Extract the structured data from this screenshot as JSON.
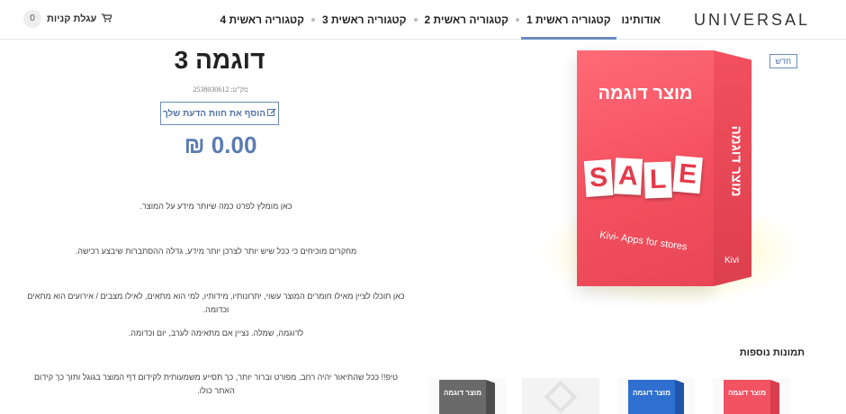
{
  "header": {
    "logo": "UNIVERSAL",
    "nav": [
      "אודותינו",
      "קטגוריה ראשית 1",
      "קטגוריה ראשית 2",
      "קטגוריה ראשית 3",
      "קטגוריה ראשית 4"
    ],
    "active_nav": "קטגוריה ראשית 1",
    "cart_label": "עגלת קניות",
    "cart_count": "0",
    "cart_icon": "shopping-cart-icon"
  },
  "product": {
    "title": "דוגמה 3",
    "sku": "מק\"ט: 2538030612",
    "review_button": "הוסף את חוות הדעת שלך",
    "review_icon": "edit-icon",
    "price": "₪ 0.00",
    "new_badge": "חדש",
    "description": [
      "כאן מומלץ לפרט כמה שיותר מידע על המוצר.",
      "מחקרים מוכיחים כי ככל שיש יותר לצרכן יותר מידע, גדלה ההסתברות שיבצע רכישה.",
      "כאן תוכלו לציין מאילו חומרים המוצר עשוי, יתרונותיו, מידותיו, למי הוא מתאים, לאילו מצבים / אירועים הוא מתאים וכדומה.",
      "לדוגמה, שמלה. נציין אם מתאימה לערב, יום וכדומה.",
      "טיפ!! ככל שהתיאור יהיה רחב, מפורט וברור יותר, כך תסייע משמעותית לקידום דף המוצר בגוגל ותוך כך קידום האתר כולו."
    ]
  },
  "main_image": {
    "box_title": "מוצר דוגמה",
    "side_text": "מוצר דוגמה",
    "sale_letters": [
      "S",
      "A",
      "L",
      "E"
    ],
    "tagline": "Kivi- Apps for stores",
    "brand": "Kivi",
    "colors": {
      "box": "#f4505f",
      "accent": "#5b7bb3"
    }
  },
  "thumbnails": {
    "title": "תמונות נוספות",
    "items": [
      {
        "label": "מוצר דוגמה",
        "color": "red"
      },
      {
        "label": "מוצר דוגמה",
        "color": "blue"
      },
      {
        "label": "",
        "color": "placeholder"
      },
      {
        "label": "מוצר דוגמה",
        "color": "gray"
      }
    ]
  }
}
